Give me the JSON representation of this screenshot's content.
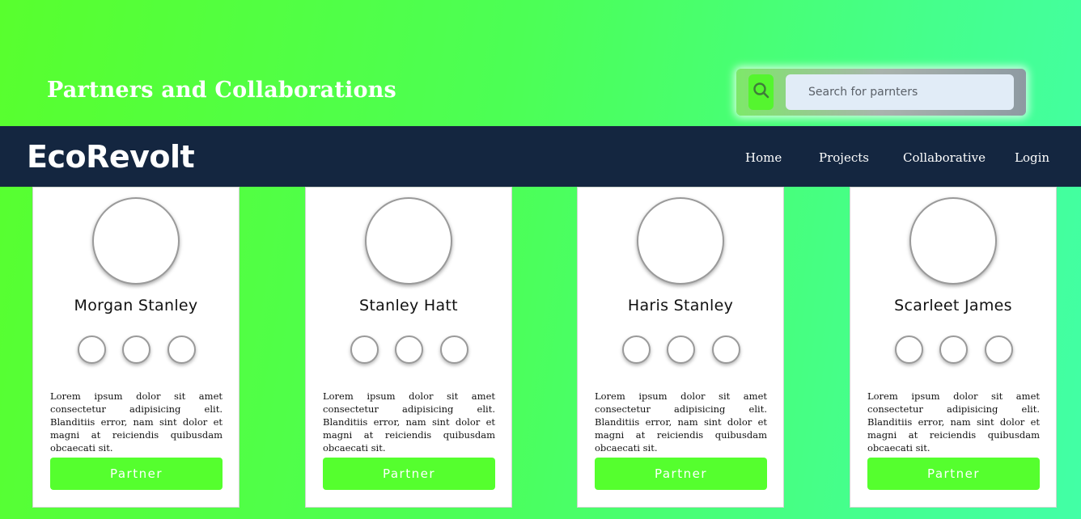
{
  "banner": {
    "title": "Partners and Collaborations",
    "search": {
      "placeholder": "Search for parnters",
      "value": ""
    }
  },
  "navbar": {
    "brand": "EcoRevolt",
    "links": [
      {
        "label": "Home"
      },
      {
        "label": "Projects"
      },
      {
        "label": "Collaborative"
      },
      {
        "label": "Login"
      }
    ]
  },
  "cards": [
    {
      "name": "Morgan Stanley",
      "description": "Lorem ipsum dolor sit amet consectetur adipisicing elit. Blanditiis error, nam sint dolor et magni at reiciendis quibusdam obcaecati sit.",
      "button_label": "Partner"
    },
    {
      "name": "Stanley Hatt",
      "description": "Lorem ipsum dolor sit amet consectetur adipisicing elit. Blanditiis error, nam sint dolor et magni at reiciendis quibusdam obcaecati sit.",
      "button_label": "Partner"
    },
    {
      "name": "Haris Stanley",
      "description": "Lorem ipsum dolor sit amet consectetur adipisicing elit. Blanditiis error, nam sint dolor et magni at reiciendis quibusdam obcaecati sit.",
      "button_label": "Partner"
    },
    {
      "name": "Scarleet James",
      "description": "Lorem ipsum dolor sit amet consectetur adipisicing elit. Blanditiis error, nam sint dolor et magni at reiciendis quibusdam obcaecati sit.",
      "button_label": "Partner"
    }
  ],
  "icons": {
    "search": "search-icon"
  },
  "colors": {
    "accent": "#55ff2e",
    "navbar": "#142640",
    "search_field": "#e1ecf7"
  }
}
